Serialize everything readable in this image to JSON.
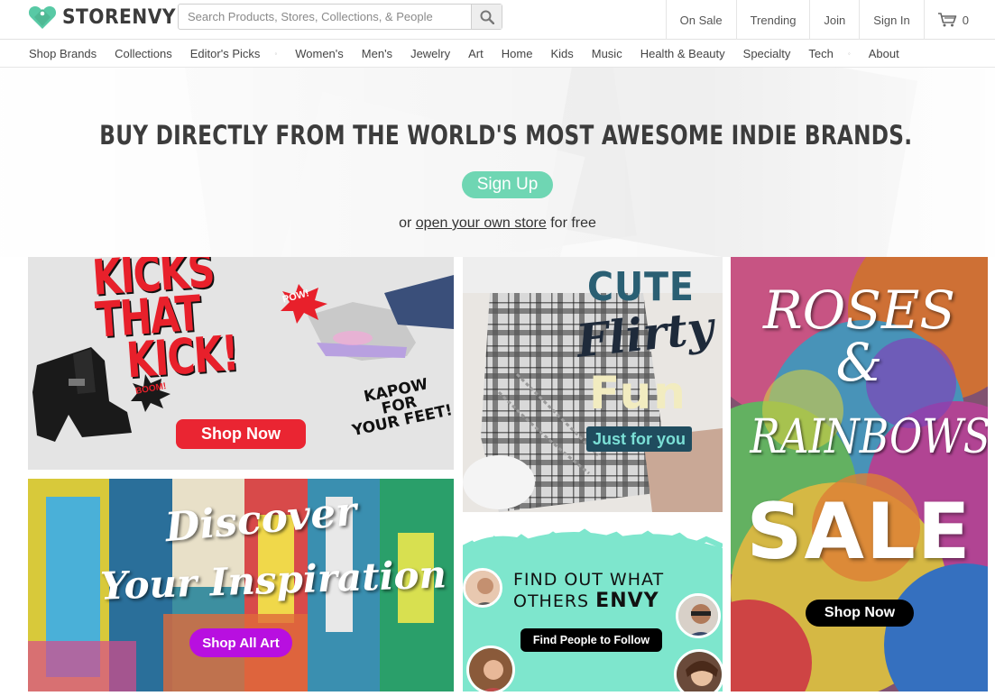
{
  "header": {
    "logo_text": "STORENVY",
    "search_placeholder": "Search Products, Stores, Collections, & People",
    "links": {
      "on_sale": "On Sale",
      "trending": "Trending",
      "join": "Join",
      "sign_in": "Sign In",
      "cart_count": "0"
    }
  },
  "nav": {
    "shop_brands": "Shop Brands",
    "collections": "Collections",
    "editors_picks": "Editor's Picks",
    "womens": "Women's",
    "mens": "Men's",
    "jewelry": "Jewelry",
    "art": "Art",
    "home": "Home",
    "kids": "Kids",
    "music": "Music",
    "health_beauty": "Health & Beauty",
    "specialty": "Specialty",
    "tech": "Tech",
    "about": "About",
    "separator": "◦"
  },
  "hero": {
    "title": "BUY DIRECTLY FROM THE WORLD'S MOST AWESOME INDIE BRANDS.",
    "signup_label": "Sign Up",
    "sub_prefix": "or",
    "sub_link": "open your own store",
    "sub_suffix": "for free"
  },
  "promos": {
    "kicks": {
      "title_line1": "KICKS",
      "title_line2": "THAT",
      "title_line3": "KICK!",
      "kapow_line1": "KAPOW",
      "kapow_line2": "FOR",
      "kapow_line3": "YOUR FEET!",
      "pow": "POW!",
      "boom": "BOOM!",
      "button": "Shop Now"
    },
    "cute": {
      "line1": "CUTE",
      "line2": "Flirty",
      "line3": "Fun",
      "tag": "Just for you"
    },
    "roses": {
      "line1": "ROSES",
      "amp": "&",
      "line2": "RAINBOWS",
      "sale": "SALE",
      "button": "Shop Now"
    },
    "art": {
      "line1": "Discover",
      "line2": "Your Inspiration",
      "button": "Shop All Art"
    },
    "envy": {
      "line1": "FIND OUT WHAT",
      "line2_prefix": "OTHERS",
      "line2_strong": "ENVY",
      "button": "Find People to Follow"
    }
  },
  "colors": {
    "brand_green": "#6fd6b3",
    "kicks_red": "#ea2532",
    "art_purple": "#b80fe0",
    "envy_mint": "#7ee6cd",
    "dark_text": "#3c3c3c"
  }
}
